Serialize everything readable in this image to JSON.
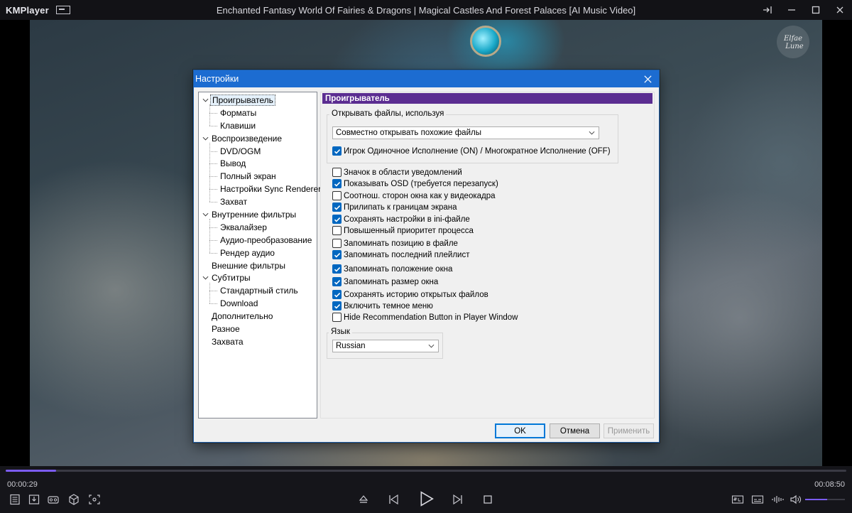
{
  "app": {
    "name": "KMPlayer",
    "video_title": "Enchanted Fantasy World Of Fairies & Dragons | Magical Castles And Forest Palaces [AI Music Video]"
  },
  "playback": {
    "elapsed": "00:00:29",
    "total": "00:08:50",
    "progress_fraction": 0.06,
    "volume_fraction": 0.55
  },
  "dialog": {
    "title": "Настройки",
    "tree": [
      {
        "label": "Проигрыватель",
        "level": 0,
        "expanded": true,
        "selected": true
      },
      {
        "label": "Форматы",
        "level": 1
      },
      {
        "label": "Клавиши",
        "level": 1
      },
      {
        "label": "Воспроизведение",
        "level": 0,
        "expanded": true
      },
      {
        "label": "DVD/OGM",
        "level": 1
      },
      {
        "label": "Вывод",
        "level": 1
      },
      {
        "label": "Полный экран",
        "level": 1
      },
      {
        "label": "Настройки Sync Renderer",
        "level": 1
      },
      {
        "label": "Захват",
        "level": 1
      },
      {
        "label": "Внутренние фильтры",
        "level": 0,
        "expanded": true
      },
      {
        "label": "Эквалайзер",
        "level": 1
      },
      {
        "label": "Аудио-преобразование",
        "level": 1
      },
      {
        "label": "Рендер аудио",
        "level": 1
      },
      {
        "label": "Внешние фильтры",
        "level": 0
      },
      {
        "label": "Субтитры",
        "level": 0,
        "expanded": true
      },
      {
        "label": "Стандартный стиль",
        "level": 1
      },
      {
        "label": "Download",
        "level": 1
      },
      {
        "label": "Дополнительно",
        "level": 0
      },
      {
        "label": "Разное",
        "level": 0
      },
      {
        "label": "Захвата",
        "level": 0
      }
    ],
    "panel": {
      "header": "Проигрыватель",
      "open_group": {
        "caption": "Открывать файлы, используя",
        "combo_value": "Совместно открывать похожие файлы",
        "single_instance": {
          "label": "Игрок Одиночное Исполнение (ON) / Многократное Исполнение (OFF)",
          "checked": true
        }
      },
      "options": [
        {
          "label": "Значок в области уведомлений",
          "checked": false
        },
        {
          "label": "Показывать OSD (требуется перезапуск)",
          "checked": true
        },
        {
          "label": "Соотнош. сторон окна как у видеокадра",
          "checked": false
        },
        {
          "label": "Прилипать к границам экрана",
          "checked": true
        },
        {
          "label": "Сохранять настройки в ini-файле",
          "checked": true
        },
        {
          "label": "Повышенный приоритет процесса",
          "checked": false
        },
        {
          "label": "Запоминать позицию в файле",
          "checked": false
        },
        {
          "label": "Запоминать последний плейлист",
          "checked": true
        },
        {
          "label": "Запоминать положение окна",
          "checked": true
        },
        {
          "label": "Запоминать размер окна",
          "checked": true
        },
        {
          "label": "Сохранять историю открытых файлов",
          "checked": true
        },
        {
          "label": "Включить темное меню",
          "checked": true
        },
        {
          "label": "Hide Recommendation Button in Player Window",
          "checked": false
        }
      ],
      "language": {
        "caption": "Язык",
        "value": "Russian"
      }
    },
    "buttons": {
      "ok": "OK",
      "cancel": "Отмена",
      "apply": "Применить"
    }
  },
  "watermark": {
    "text": "Elfae Lune"
  },
  "colors": {
    "accent": "#7b5cf0",
    "dialog_title": "#1c6cd1",
    "panel_header": "#5b2d91",
    "checkbox": "#0067c0"
  }
}
